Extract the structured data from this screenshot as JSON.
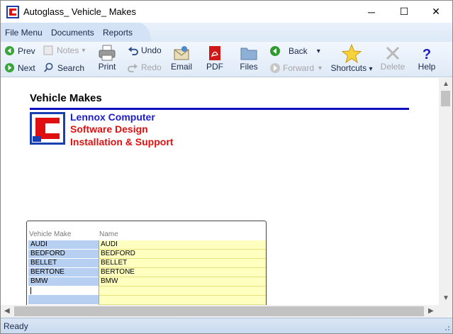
{
  "window": {
    "title": "Autoglass_ Vehicle_ Makes",
    "minimize": "─",
    "maximize": "☐",
    "close": "✕"
  },
  "menu": {
    "items": [
      "File Menu",
      "Documents",
      "Reports"
    ]
  },
  "toolbar": {
    "prev": "Prev",
    "next": "Next",
    "notes": "Notes",
    "search": "Search",
    "print": "Print",
    "undo": "Undo",
    "redo": "Redo",
    "email": "Email",
    "pdf": "PDF",
    "files": "Files",
    "back": "Back",
    "forward": "Forward",
    "shortcuts": "Shortcuts",
    "delete": "Delete",
    "help": "Help",
    "dropdown_glyph": "▾"
  },
  "page": {
    "title": "Vehicle Makes",
    "company_line1": "Lennox Computer",
    "company_line2": "Software Design",
    "company_line3": "Installation & Support"
  },
  "grid": {
    "headers": [
      "Vehicle Make",
      "Name"
    ],
    "rows": [
      {
        "make": "AUDI",
        "name": "AUDI"
      },
      {
        "make": "BEDFORD",
        "name": "BEDFORD"
      },
      {
        "make": "BELLET",
        "name": "BELLET"
      },
      {
        "make": "BERTONE",
        "name": "BERTONE"
      },
      {
        "make": "BMW",
        "name": "BMW"
      }
    ]
  },
  "status": {
    "text": "Ready"
  },
  "colors": {
    "accent_blue": "#1c1cd0",
    "accent_red": "#e01010",
    "make_column": "#b7cff0",
    "name_column": "#ffffc0"
  }
}
